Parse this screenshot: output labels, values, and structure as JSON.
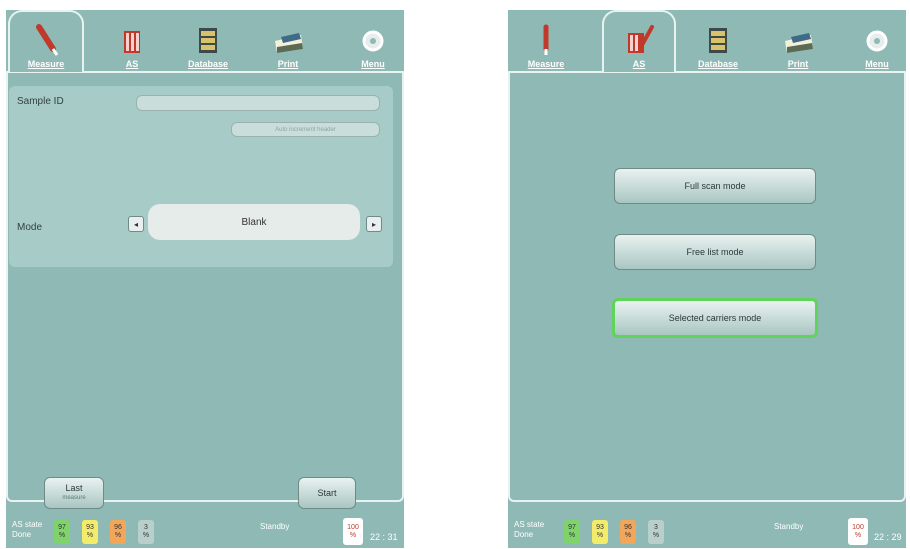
{
  "tabs": [
    {
      "label": "Measure",
      "icon": "pipette-icon"
    },
    {
      "label": "AS",
      "icon": "sample-rack-icon"
    },
    {
      "label": "Database",
      "icon": "database-icon"
    },
    {
      "label": "Print",
      "icon": "printer-icon"
    },
    {
      "label": "Menu",
      "icon": "gear-icon"
    }
  ],
  "left": {
    "active_tab": "Measure",
    "sample_id_label": "Sample ID",
    "sample_id_value": "",
    "auto_increment_label": "Auto increment header",
    "mode_label": "Mode",
    "mode_value": "Blank",
    "last_button": "Last",
    "last_button_sub": "measure",
    "start_button": "Start"
  },
  "right": {
    "active_tab": "AS",
    "buttons": [
      "Full scan mode",
      "Free list mode",
      "Selected carriers mode"
    ],
    "selected_button": "Selected carriers mode"
  },
  "status": {
    "as_state_label": "AS state",
    "done_label": "Done",
    "chips": [
      {
        "value": "97",
        "unit": "%",
        "color": "#7fd36b"
      },
      {
        "value": "93",
        "unit": "%",
        "color": "#f3ec6a"
      },
      {
        "value": "96",
        "unit": "%",
        "color": "#f2a65a"
      },
      {
        "value": "3",
        "unit": "%",
        "color": "#b9cfcc"
      }
    ],
    "standby": "Standby",
    "percent_value": "100",
    "percent_unit": "%",
    "time_left": "22 : 31",
    "time_right": "22 : 29"
  },
  "colors": {
    "background": "#8eb9b5",
    "panel": "#a7ccc7",
    "selected": "#5fd35a"
  }
}
